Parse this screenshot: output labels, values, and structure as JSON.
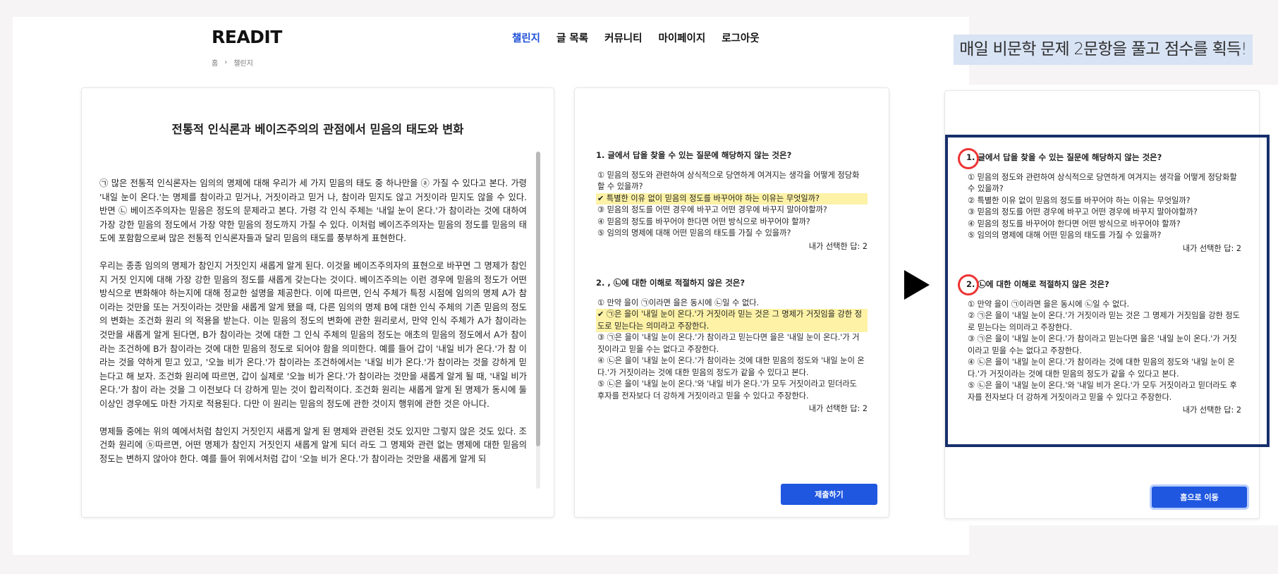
{
  "app": {
    "logo": "READIT"
  },
  "nav": {
    "items": [
      "챌린지",
      "글 목록",
      "커뮤니티",
      "마이페이지",
      "로그아웃"
    ],
    "active": "챌린지"
  },
  "breadcrumb": {
    "home": "홈",
    "separator": "›",
    "current": "챌린지"
  },
  "passage": {
    "title": "전통적 인식론과 베이즈주의의 관점에서 믿음의 태도와 변화",
    "paragraphs": [
      "㉠ 많은 전통적 인식론자는 임의의 명제에 대해 우리가 세 가지 믿음의 태도 중 하나만을 ⓐ 가질 수 있다고 본다. 가령 '내일 눈이 온다.'는 명제를 참이라고 믿거나, 거짓이라고 믿거 나, 참이라 믿지도 않고 거짓이라 믿지도 않을 수 있다. 반면 ㉡ 베이즈주의자는 믿음은 정도의 문제라고 본다. 가령 각 인식 주체는 '내일 눈이 온다.'가 참이라는 것에 대하여 가장 강한 믿음의 정도에서 가장 약한 믿음의 정도까지 가질 수 있다. 이처럼 베이즈주의자는 믿음의 정도를 믿음의 태도에 포함함으로써 많은 전통적 인식론자들과 달리 믿음의 태도를 풍부하게 표현한다.",
      "우리는 종종 임의의 명제가 참인지 거짓인지 새롭게 알게 된다. 이것을 베이즈주의자의 표현으로 바꾸면 그 명제가 참인지 거짓 인지에 대해 가장 강한 믿음의 정도를 새롭게 갖는다는 것이다. 베이즈주의는 이런 경우에 믿음의 정도가 어떤 방식으로 변화해야 하는지에 대해 정교한 설명을 제공한다. 이에 따르면, 인식 주체가 특정 시점에 임의의 명제 A가 참이라는 것만을 또는 거짓이라는 것만을 새롭게 알게 됐을 때, 다른 임의의 명제 B에 대한 인식 주체의 기존 믿음의 정도의 변화는 조건화 원리 의 적용을 받는다. 이는 믿음의 정도의 변화에 관한 원리로서, 만약 인식 주체가 A가 참이라는 것만을 새롭게 알게 된다면, B가 참이라는 것에 대한 그 인식 주체의 믿음의 정도는 애초의 믿음의 정도에서 A가 참이라는 조건하에 B가 참이라는 것에 대한 믿음의 정도로 되어야 함을 의미한다. 예를 들어 갑이 '내일 비가 온다.'가 참 이라는 것을 약하게 믿고 있고, '오늘 비가 온다.'가 참이라는 조건하에서는 '내일 비가 온다.'가 참이라는 것을 강하게 믿는다고 해 보자. 조건화 원리에 따르면, 갑이 실제로 '오늘 비가 온다.'가 참이라는 것만을 새롭게 알게 될 때, '내일 비가 온다.'가 참이 라는 것을 그 이전보다 더 강하게 믿는 것이 합리적이다. 조건화 원리는 새롭게 알게 된 명제가 동시에 둘 이상인 경우에도 마찬 가지로 적용된다. 다만 이 원리는 믿음의 정도에 관한 것이지 행위에 관한 것은 아니다.",
      "명제들 중에는 위의 예에서처럼 참인지 거짓인지 새롭게 알게 된 명제와 관련된 것도 있지만 그렇지 않은 것도 있다. 조건화 원리에 ⓑ따르면, 어떤 명제가 참인지 거짓인지 새롭게 알게 되더 라도 그 명제와 관련 없는 명제에 대한 믿음의 정도는 변하지 않아야 한다. 예를 들어 위에서처럼 갑이 '오늘 비가 온다.'가 참이라는 것만을 새롭게 알게 되"
    ]
  },
  "quiz": {
    "questions": [
      {
        "title": "1. 글에서 답을 찾을 수 있는 질문에 해당하지 않는 것은?",
        "options": [
          "① 믿음의 정도와 관련하여 상식적으로 당연하게 여겨지는 생각을 어떻게 정당화할 수 있을까?",
          "✔ 특별한 이유 없이 믿음의 정도를 바꾸어야 하는 이유는 무엇일까?",
          "③ 믿음의 정도를 어떤 경우에 바꾸고 어떤 경우에 바꾸지 말아야할까?",
          "④ 믿음의 정도를 바꾸어야 한다면 어떤 방식으로 바꾸어야 할까?",
          "⑤ 임의의 명제에 대해 어떤 믿음의 태도를 가질 수 있을까?"
        ],
        "selected_index": 1,
        "my_answer": "내가 선택한 답: 2"
      },
      {
        "title": "2. , ㉡에 대한 이해로 적절하지 않은 것은?",
        "options": [
          "① 만약 을이 ㉠이라면 을은 동시에 ㉡일 수 없다.",
          "✔ ㉠은 을이 '내일 눈이 온다.'가 거짓이라 믿는 것은 그 명제가 거짓임을 강한 정도로 믿는다는 의미라고 주장한다.",
          "③ ㉠은 을이 '내일 눈이 온다.'가 참이라고 믿는다면 을은 '내일 눈이 온다.'가 거짓이라고 믿을 수는 없다고 주장한다.",
          "④ ㉡은 을이 '내일 눈이 온다.'가 참이라는 것에 대한 믿음의 정도와 '내일 눈이 온다.'가 거짓이라는 것에 대한 믿음의 정도가 같을 수 있다고 본다.",
          "⑤ ㉡은 을이 '내일 눈이 온다.'와 '내일 비가 온다.'가 모두 거짓이라고 믿더라도 후자를 전자보다 더 강하게 거짓이라고 믿을 수 있다고 주장한다."
        ],
        "selected_index": 1,
        "my_answer": "내가 선택한 답: 2"
      }
    ],
    "submit_label": "제출하기"
  },
  "caption": "매일 비문학 문제 2문항을 풀고 점수를 획득!",
  "result": {
    "questions": [
      {
        "number": "1.",
        "title": "글에서 답을 찾을 수 있는 질문에 해당하지 않는 것은?",
        "options": [
          "① 믿음의 정도와 관련하여 상식적으로 당연하게 여겨지는 생각을 어떻게 정당화할 수 있을까?",
          "② 특별한 이유 없이 믿음의 정도를 바꾸어야 하는 이유는 무엇일까?",
          "③ 믿음의 정도를 어떤 경우에 바꾸고 어떤 경우에 바꾸지 말아야할까?",
          "④ 믿음의 정도를 바꾸어야 한다면 어떤 방식으로 바꾸어야 할까?",
          "⑤ 임의의 명제에 대해 어떤 믿음의 태도를 가질 수 있을까?"
        ],
        "my_answer": "내가 선택한 답: 2"
      },
      {
        "number": "2.",
        "title": "㉡에 대한 이해로 적절하지 않은 것은?",
        "options": [
          "① 만약 을이 ㉠이라면 을은 동시에 ㉡일 수 없다.",
          "② ㉠은 을이 '내일 눈이 온다.'가 거짓이라 믿는 것은 그 명제가 거짓임을 강한 정도로 믿는다는 의미라고 주장한다.",
          "③ ㉠은 을이 '내일 눈이 온다.'가 참이라고 믿는다면 을은 '내일 눈이 온다.'가 거짓이라고 믿을 수는 없다고 주장한다.",
          "④ ㉡은 을이 '내일 눈이 온다.'가 참이라는 것에 대한 믿음의 정도와 '내일 눈이 온다.'가 거짓이라는 것에 대한 믿음의 정도가 같을 수 있다고 본다.",
          "⑤ ㉡은 을이 '내일 눈이 온다.'와 '내일 비가 온다.'가 모두 거짓이라고 믿더라도 후자를 전자보다 더 강하게 거짓이라고 믿을 수 있다고 주장한다."
        ],
        "my_answer": "내가 선택한 답: 2"
      }
    ],
    "home_label": "홈으로 이동"
  },
  "colors": {
    "accent": "#1f57e0",
    "highlight": "#fdf2a6",
    "frame": "#172f6c",
    "marker": "#e33333",
    "caption_bg": "#d8e3f4"
  }
}
